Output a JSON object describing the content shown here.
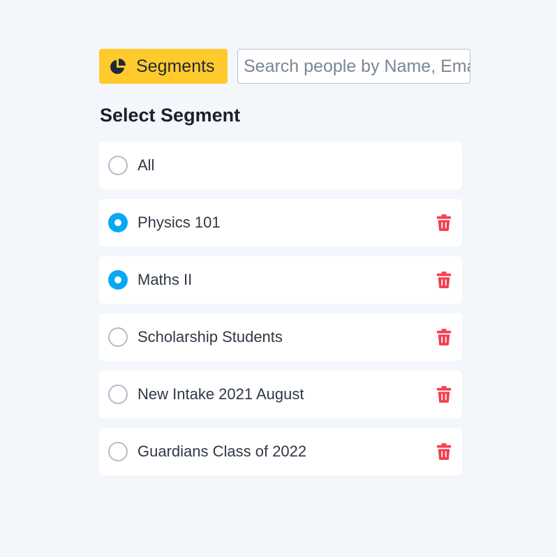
{
  "toolbar": {
    "segments_button": {
      "label": "Segments",
      "icon": "pie-chart-icon"
    },
    "search": {
      "placeholder": "Search people by Name, Email"
    }
  },
  "section_title": "Select Segment",
  "segments": [
    {
      "label": "All",
      "checked": false,
      "deletable": false
    },
    {
      "label": "Physics 101",
      "checked": true,
      "deletable": true
    },
    {
      "label": "Maths II",
      "checked": true,
      "deletable": true
    },
    {
      "label": "Scholarship Students",
      "checked": false,
      "deletable": true
    },
    {
      "label": "New Intake 2021 August",
      "checked": false,
      "deletable": true
    },
    {
      "label": "Guardians Class of 2022",
      "checked": false,
      "deletable": true
    }
  ],
  "colors": {
    "background": "#f3f6fa",
    "accent_yellow": "#ffca2c",
    "radio_checked": "#08a8f4",
    "delete_red": "#f53d4c"
  }
}
